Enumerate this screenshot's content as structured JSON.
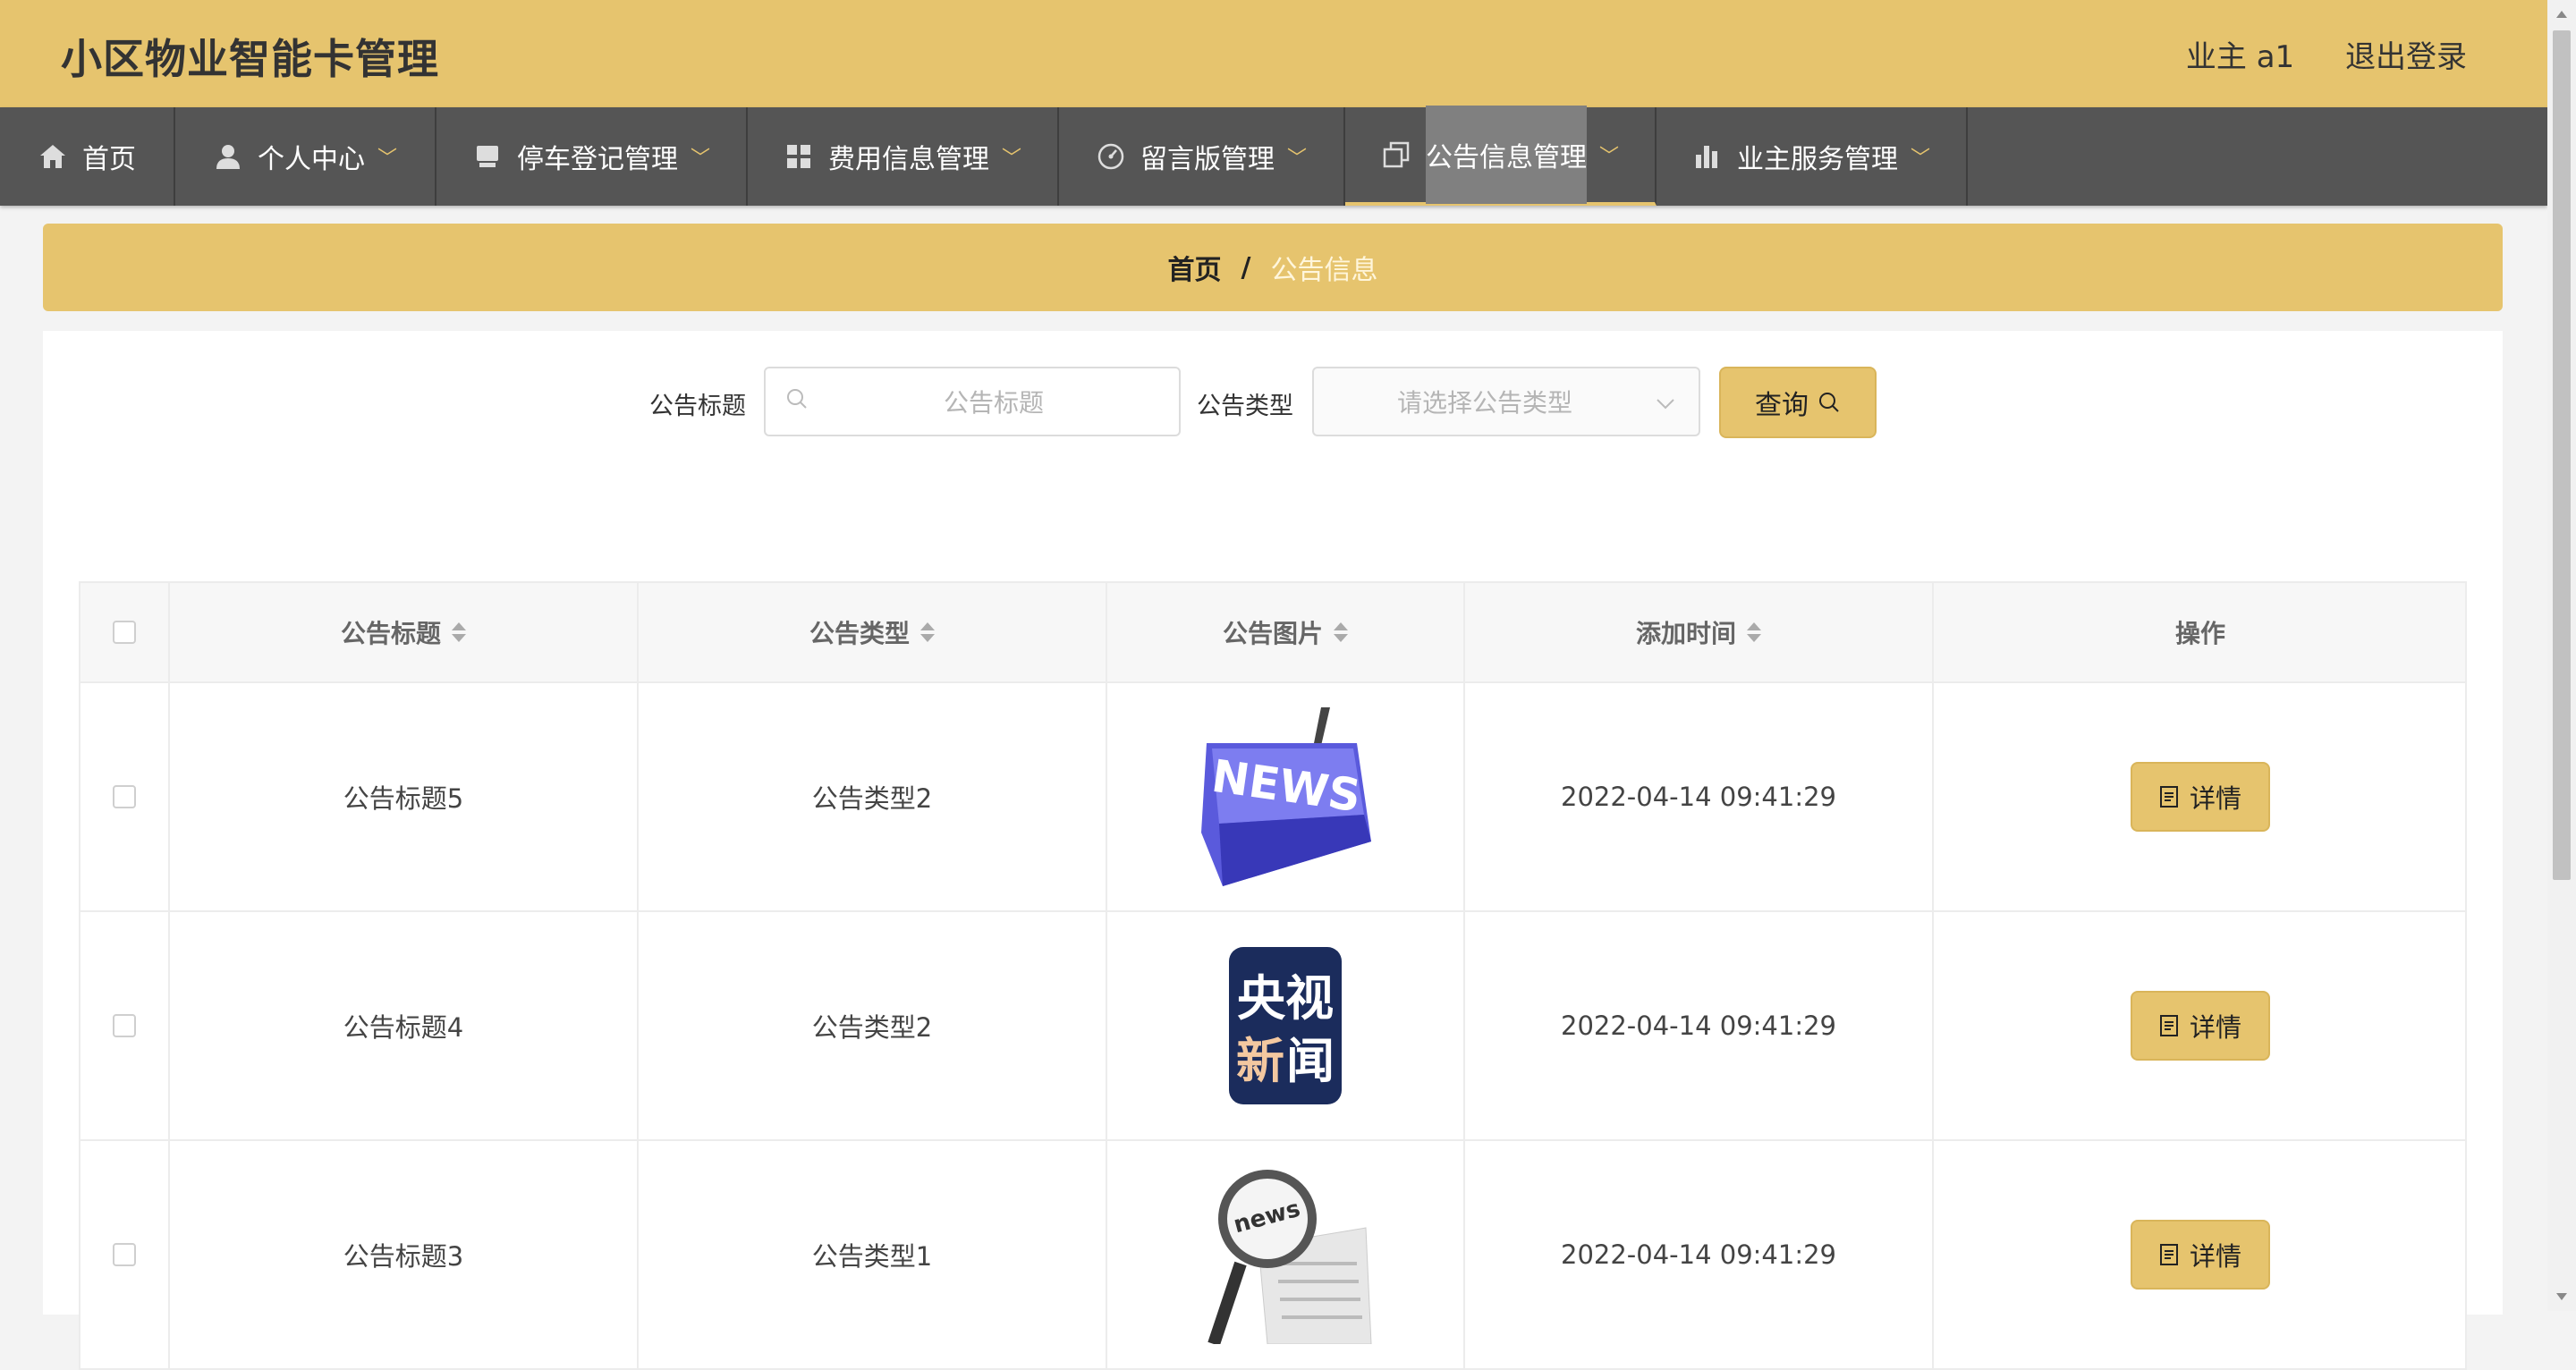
{
  "header": {
    "title": "小区物业智能卡管理",
    "user_label": "业主 a1",
    "logout_label": "退出登录"
  },
  "nav": [
    {
      "label": "首页",
      "icon": "home-icon"
    },
    {
      "label": "个人中心",
      "icon": "user-icon"
    },
    {
      "label": "停车登记管理",
      "icon": "parking-icon"
    },
    {
      "label": "费用信息管理",
      "icon": "grid-icon"
    },
    {
      "label": "留言版管理",
      "icon": "gauge-icon"
    },
    {
      "label": "公告信息管理",
      "icon": "copy-icon",
      "active": true
    },
    {
      "label": "业主服务管理",
      "icon": "bar-chart-icon"
    }
  ],
  "breadcrumb": {
    "home": "首页",
    "separator": "/",
    "current": "公告信息"
  },
  "search": {
    "title_label": "公告标题",
    "title_placeholder": "公告标题",
    "type_label": "公告类型",
    "type_placeholder": "请选择公告类型",
    "query_label": "查询"
  },
  "table": {
    "columns": [
      "公告标题",
      "公告类型",
      "公告图片",
      "添加时间",
      "操作"
    ],
    "rows": [
      {
        "title": "公告标题5",
        "type": "公告类型2",
        "image": "news-keyboard-image",
        "time": "2022-04-14 09:41:29",
        "action": "详情"
      },
      {
        "title": "公告标题4",
        "type": "公告类型2",
        "image": "cctv-news-logo-image",
        "time": "2022-04-14 09:41:29",
        "action": "详情"
      },
      {
        "title": "公告标题3",
        "type": "公告类型1",
        "image": "news-magnifier-image",
        "time": "2022-04-14 09:41:29",
        "action": "详情"
      }
    ]
  },
  "image_text": {
    "news_key": "NEWS",
    "cctv_line1": "央视",
    "cctv_line2_a": "新",
    "cctv_line2_b": "闻",
    "magnifier": "news"
  },
  "colors": {
    "accent": "#e6c46e",
    "nav_bg": "#555555",
    "nav_active": "#808080"
  }
}
